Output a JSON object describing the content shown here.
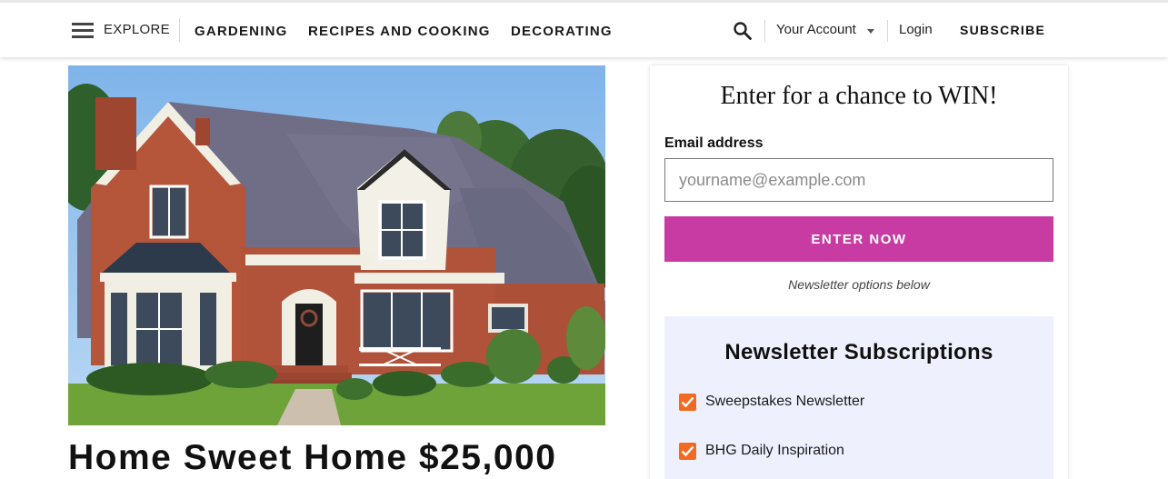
{
  "header": {
    "explore_label": "EXPLORE",
    "nav": [
      "GARDENING",
      "RECIPES AND COOKING",
      "DECORATING"
    ],
    "account_label": "Your Account",
    "login_label": "Login",
    "subscribe_label": "SUBSCRIBE",
    "icons": [
      "menu-icon",
      "search-icon",
      "chevron-down-icon"
    ]
  },
  "hero": {
    "headline": "Home Sweet Home $25,000"
  },
  "entry_form": {
    "title": "Enter for a chance to WIN!",
    "email_label": "Email address",
    "email_placeholder": "yourname@example.com",
    "email_value": "",
    "submit_label": "ENTER NOW",
    "newsletter_note": "Newsletter options below",
    "accent_color": "#c83ba3"
  },
  "newsletters": {
    "title": "Newsletter Subscriptions",
    "checkbox_color": "#f26a21",
    "background": "#eef1fd",
    "items": [
      {
        "label": "Sweepstakes Newsletter",
        "checked": true
      },
      {
        "label": "BHG Daily Inspiration",
        "checked": true
      }
    ]
  }
}
